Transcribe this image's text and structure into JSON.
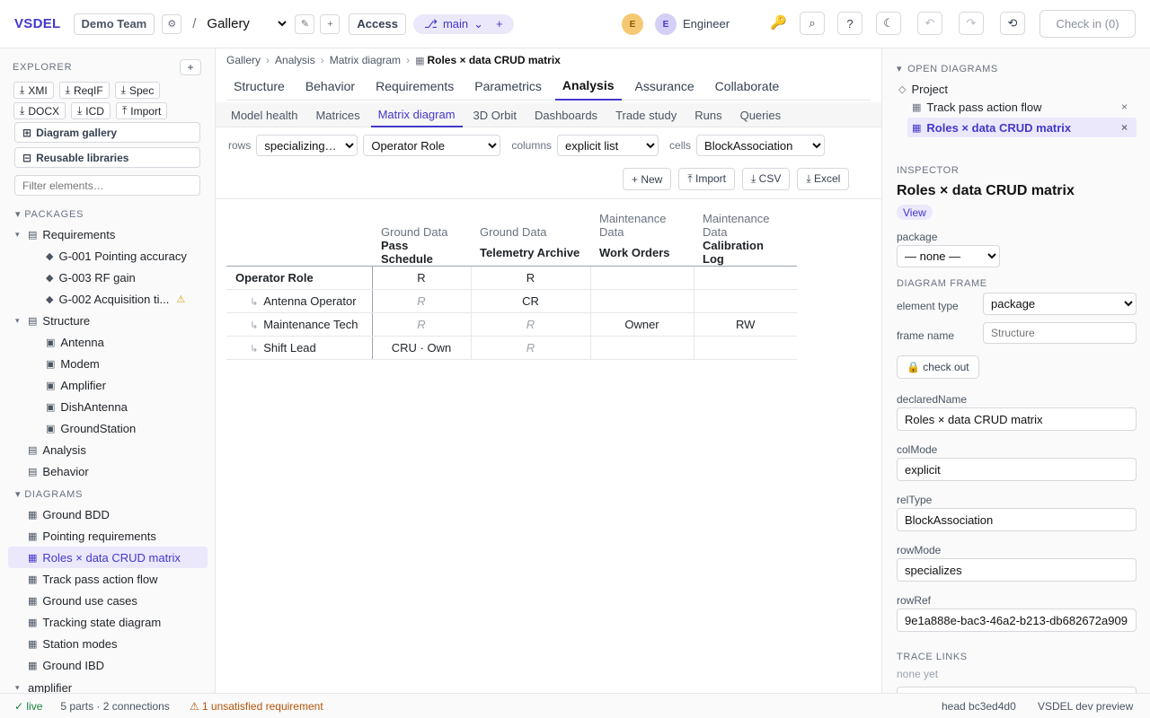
{
  "topbar": {
    "brand": "VSDEL",
    "team": "Demo Team",
    "gear_glyph": "⚙",
    "slash": "/",
    "gallery": "Gallery",
    "edit_glyph": "✎",
    "plus_glyph": "+",
    "access": "Access",
    "branch_glyph": "⎇",
    "branch": "main",
    "branch_caret": "⌄",
    "avatar1": "E",
    "avatar2": "E",
    "user": "Engineer",
    "key_glyph": "🔑",
    "search_glyph": "⌕",
    "help_glyph": "?",
    "theme_glyph": "☾",
    "undo_glyph": "↶",
    "redo_glyph": "↷",
    "history_glyph": "⟲",
    "checkin": "Check in (0)"
  },
  "sidebar": {
    "explorer_title": "EXPLORER",
    "add_glyph": "+",
    "export_row1": [
      {
        "glyph": "⤓",
        "label": "XMI"
      },
      {
        "glyph": "⤓",
        "label": "ReqIF"
      },
      {
        "glyph": "⤓",
        "label": "Spec"
      }
    ],
    "export_row2": [
      {
        "glyph": "⤓",
        "label": "DOCX"
      },
      {
        "glyph": "⤓",
        "label": "ICD"
      },
      {
        "glyph": "⤒",
        "label": "Import"
      }
    ],
    "gallery_glyph": "⊞",
    "diagram_gallery": "Diagram gallery",
    "libraries_glyph": "⊟",
    "reusable_libraries": "Reusable libraries",
    "filter_placeholder": "Filter elements…",
    "packages_title": "PACKAGES",
    "diagrams_title": "DIAGRAMS",
    "tree_toggle": "▾",
    "pkg_glyph": "▤",
    "req_glyph": "◆",
    "block_glyph": "▣",
    "diag_glyph": "▦",
    "warn_glyph": "⚠",
    "requirements": "Requirements",
    "req_items": [
      "G-001 Pointing accuracy",
      "G-003 RF gain",
      "G-002 Acquisition ti..."
    ],
    "structure": "Structure",
    "structure_items": [
      "Antenna",
      "Modem",
      "Amplifier",
      "DishAntenna",
      "GroundStation"
    ],
    "analysis": "Analysis",
    "behavior": "Behavior",
    "diagram_items": [
      "Ground BDD",
      "Pointing requirements",
      "Roles × data CRUD matrix",
      "Track pass action flow",
      "Ground use cases",
      "Tracking state diagram",
      "Station modes",
      "Ground IBD"
    ],
    "cutoff_item": "amplifier"
  },
  "center": {
    "breadcrumb": [
      "Gallery",
      "Analysis",
      "Matrix diagram",
      "Roles × data CRUD matrix"
    ],
    "breadcrumb_sep": "›",
    "breadcrumb_glyph": "▦",
    "tabs": [
      "Structure",
      "Behavior",
      "Requirements",
      "Parametrics",
      "Analysis",
      "Assurance",
      "Collaborate"
    ],
    "subtabs": [
      "Model health",
      "Matrices",
      "Matrix diagram",
      "3D Orbit",
      "Dashboards",
      "Trade study",
      "Runs",
      "Queries"
    ],
    "rows_label": "rows",
    "rows_mode": "specializing…",
    "rows_ref": "Operator Role",
    "columns_label": "columns",
    "columns_mode": "explicit list",
    "cells_label": "cells",
    "cells_type": "BlockAssociation",
    "actions": [
      "+ New",
      "⤒ Import",
      "⤓ CSV",
      "⤓ Excel"
    ],
    "elbow": "↳",
    "matrix": {
      "groups": [
        "Ground Data",
        "Ground Data",
        "Maintenance Data",
        "Maintenance Data"
      ],
      "columns": [
        "Pass Schedule",
        "Telemetry Archive",
        "Work Orders",
        "Calibration Log"
      ],
      "rows": [
        {
          "label": "Operator Role",
          "cells": [
            "R",
            "R",
            "",
            ""
          ]
        },
        {
          "label": "Antenna Operator",
          "cells": [
            "R",
            "CR",
            "",
            ""
          ]
        },
        {
          "label": "Maintenance Tech",
          "cells": [
            "R",
            "R",
            "Owner",
            "RW"
          ]
        },
        {
          "label": "Shift Lead",
          "cells": [
            "CRU · Own",
            "R",
            "",
            ""
          ]
        }
      ]
    }
  },
  "right": {
    "open_diagrams_title": "OPEN DIAGRAMS",
    "open_toggle": "▾",
    "project_glyph": "◇",
    "project": "Project",
    "diag_glyph": "▦",
    "close_glyph": "×",
    "open_items": [
      "Track pass action flow",
      "Roles × data CRUD matrix"
    ],
    "inspector_title": "INSPECTOR",
    "name": "Roles × data CRUD matrix",
    "badge": "View",
    "package_label": "package",
    "package_value": "— none —",
    "frame_title": "DIAGRAM FRAME",
    "element_type_label": "element type",
    "element_type_value": "package",
    "frame_name_label": "frame name",
    "frame_name_placeholder": "Structure",
    "checkout": "🔒 check out",
    "fields": [
      {
        "label": "declaredName",
        "value": "Roles × data CRUD matrix"
      },
      {
        "label": "colMode",
        "value": "explicit"
      },
      {
        "label": "relType",
        "value": "BlockAssociation"
      },
      {
        "label": "rowMode",
        "value": "specializes"
      },
      {
        "label": "rowRef",
        "value": "9e1a888e-bac3-46a2-b213-db682672a909"
      }
    ],
    "trace_title": "TRACE LINKS",
    "trace_none": "none yet"
  },
  "status": {
    "live": "✓ live",
    "parts": "5 parts · 2 connections",
    "warning": "⚠ 1 unsatisfied requirement",
    "head": "head bc3ed4d0",
    "preview": "VSDEL dev preview"
  }
}
